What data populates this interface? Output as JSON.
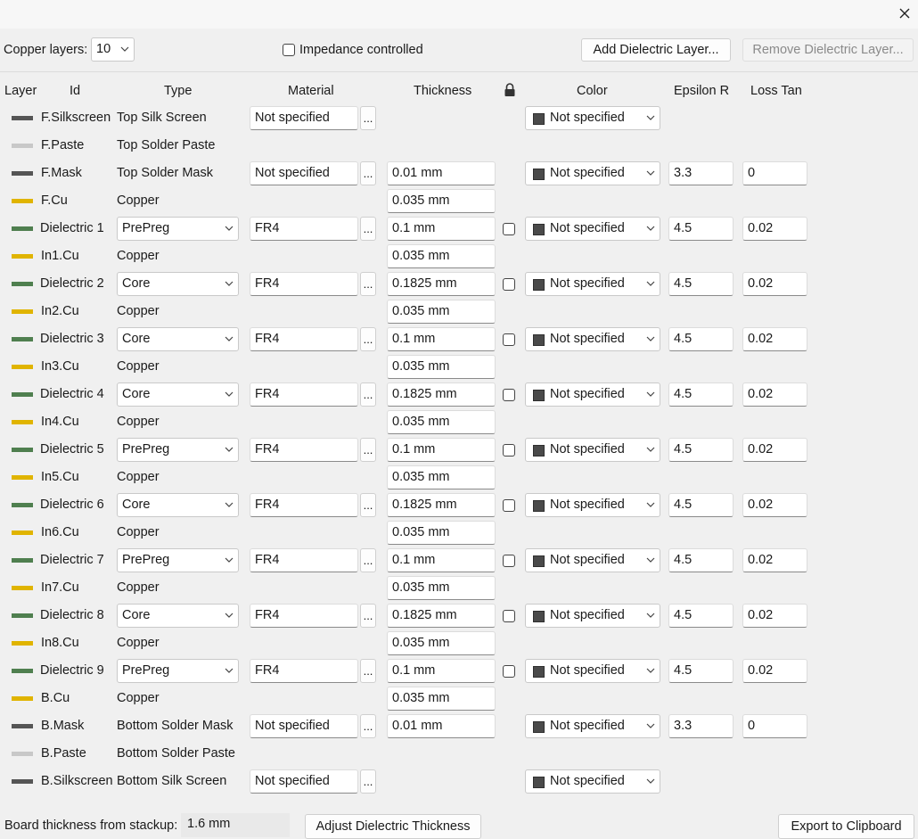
{
  "window": {
    "close_icon": "close-icon"
  },
  "toolbar": {
    "copper_layers_label": "Copper layers:",
    "copper_layers_value": "10",
    "impedance_label": "Impedance controlled",
    "impedance_checked": false,
    "add_dielectric_label": "Add Dielectric Layer...",
    "remove_dielectric_label": "Remove Dielectric Layer..."
  },
  "headers": {
    "layer": "Layer",
    "id": "Id",
    "type": "Type",
    "material": "Material",
    "thickness": "Thickness",
    "lock_icon": "lock-icon",
    "color": "Color",
    "epsilon_r": "Epsilon R",
    "loss_tan": "Loss Tan"
  },
  "colors": {
    "silkscreen": "#555555",
    "paste": "#c8c8c8",
    "mask": "#555555",
    "copper": "#e0b400",
    "dielectric": "#4f7f4f",
    "color_swatch": "#4a4a4a"
  },
  "layers": [
    {
      "id": "F.Silkscreen",
      "kind": "silkscreen",
      "type": "Top Silk Screen",
      "material": "Not specified",
      "thickness": "",
      "color": "Not specified",
      "epsilon": "",
      "loss": ""
    },
    {
      "id": "F.Paste",
      "kind": "paste",
      "type": "Top Solder Paste",
      "material": "",
      "thickness": "",
      "color": "",
      "epsilon": "",
      "loss": ""
    },
    {
      "id": "F.Mask",
      "kind": "mask",
      "type": "Top Solder Mask",
      "material": "Not specified",
      "thickness": "0.01 mm",
      "color": "Not specified",
      "epsilon": "3.3",
      "loss": "0"
    },
    {
      "id": "F.Cu",
      "kind": "copper",
      "type": "Copper",
      "material": "",
      "thickness": "0.035 mm",
      "color": "",
      "epsilon": "",
      "loss": ""
    },
    {
      "id": "Dielectric 1",
      "kind": "dielectric",
      "type": "PrePreg",
      "material": "FR4",
      "thickness": "0.1 mm",
      "color": "Not specified",
      "epsilon": "4.5",
      "loss": "0.02"
    },
    {
      "id": "In1.Cu",
      "kind": "copper",
      "type": "Copper",
      "material": "",
      "thickness": "0.035 mm",
      "color": "",
      "epsilon": "",
      "loss": ""
    },
    {
      "id": "Dielectric 2",
      "kind": "dielectric",
      "type": "Core",
      "material": "FR4",
      "thickness": "0.1825 mm",
      "color": "Not specified",
      "epsilon": "4.5",
      "loss": "0.02"
    },
    {
      "id": "In2.Cu",
      "kind": "copper",
      "type": "Copper",
      "material": "",
      "thickness": "0.035 mm",
      "color": "",
      "epsilon": "",
      "loss": ""
    },
    {
      "id": "Dielectric 3",
      "kind": "dielectric",
      "type": "Core",
      "material": "FR4",
      "thickness": "0.1 mm",
      "color": "Not specified",
      "epsilon": "4.5",
      "loss": "0.02"
    },
    {
      "id": "In3.Cu",
      "kind": "copper",
      "type": "Copper",
      "material": "",
      "thickness": "0.035 mm",
      "color": "",
      "epsilon": "",
      "loss": ""
    },
    {
      "id": "Dielectric 4",
      "kind": "dielectric",
      "type": "Core",
      "material": "FR4",
      "thickness": "0.1825 mm",
      "color": "Not specified",
      "epsilon": "4.5",
      "loss": "0.02"
    },
    {
      "id": "In4.Cu",
      "kind": "copper",
      "type": "Copper",
      "material": "",
      "thickness": "0.035 mm",
      "color": "",
      "epsilon": "",
      "loss": ""
    },
    {
      "id": "Dielectric 5",
      "kind": "dielectric",
      "type": "PrePreg",
      "material": "FR4",
      "thickness": "0.1 mm",
      "color": "Not specified",
      "epsilon": "4.5",
      "loss": "0.02"
    },
    {
      "id": "In5.Cu",
      "kind": "copper",
      "type": "Copper",
      "material": "",
      "thickness": "0.035 mm",
      "color": "",
      "epsilon": "",
      "loss": ""
    },
    {
      "id": "Dielectric 6",
      "kind": "dielectric",
      "type": "Core",
      "material": "FR4",
      "thickness": "0.1825 mm",
      "color": "Not specified",
      "epsilon": "4.5",
      "loss": "0.02"
    },
    {
      "id": "In6.Cu",
      "kind": "copper",
      "type": "Copper",
      "material": "",
      "thickness": "0.035 mm",
      "color": "",
      "epsilon": "",
      "loss": ""
    },
    {
      "id": "Dielectric 7",
      "kind": "dielectric",
      "type": "PrePreg",
      "material": "FR4",
      "thickness": "0.1 mm",
      "color": "Not specified",
      "epsilon": "4.5",
      "loss": "0.02"
    },
    {
      "id": "In7.Cu",
      "kind": "copper",
      "type": "Copper",
      "material": "",
      "thickness": "0.035 mm",
      "color": "",
      "epsilon": "",
      "loss": ""
    },
    {
      "id": "Dielectric 8",
      "kind": "dielectric",
      "type": "Core",
      "material": "FR4",
      "thickness": "0.1825 mm",
      "color": "Not specified",
      "epsilon": "4.5",
      "loss": "0.02"
    },
    {
      "id": "In8.Cu",
      "kind": "copper",
      "type": "Copper",
      "material": "",
      "thickness": "0.035 mm",
      "color": "",
      "epsilon": "",
      "loss": ""
    },
    {
      "id": "Dielectric 9",
      "kind": "dielectric",
      "type": "PrePreg",
      "material": "FR4",
      "thickness": "0.1 mm",
      "color": "Not specified",
      "epsilon": "4.5",
      "loss": "0.02"
    },
    {
      "id": "B.Cu",
      "kind": "copper",
      "type": "Copper",
      "material": "",
      "thickness": "0.035 mm",
      "color": "",
      "epsilon": "",
      "loss": ""
    },
    {
      "id": "B.Mask",
      "kind": "mask",
      "type": "Bottom Solder Mask",
      "material": "Not specified",
      "thickness": "0.01 mm",
      "color": "Not specified",
      "epsilon": "3.3",
      "loss": "0"
    },
    {
      "id": "B.Paste",
      "kind": "paste",
      "type": "Bottom Solder Paste",
      "material": "",
      "thickness": "",
      "color": "",
      "epsilon": "",
      "loss": ""
    },
    {
      "id": "B.Silkscreen",
      "kind": "silkscreen",
      "type": "Bottom Silk Screen",
      "material": "Not specified",
      "thickness": "",
      "color": "Not specified",
      "epsilon": "",
      "loss": ""
    }
  ],
  "footer": {
    "board_thickness_label": "Board thickness from stackup:",
    "board_thickness_value": "1.6 mm",
    "adjust_label": "Adjust Dielectric Thickness",
    "export_label": "Export to Clipboard"
  }
}
